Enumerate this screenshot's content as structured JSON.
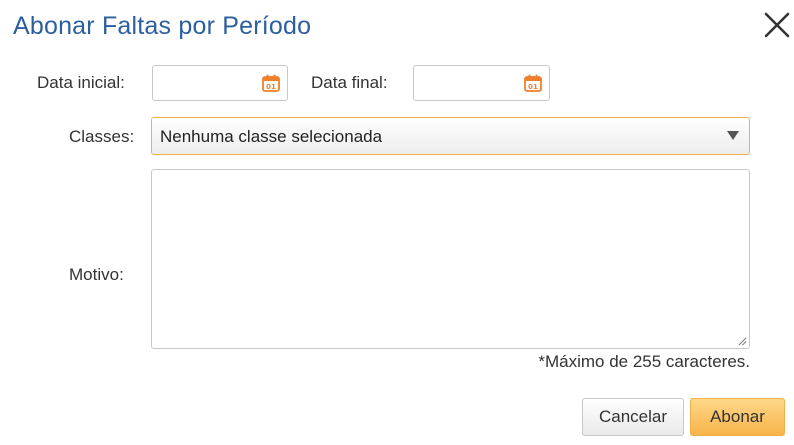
{
  "dialog": {
    "title": "Abonar Faltas por Período"
  },
  "form": {
    "start_date_label": "Data inicial:",
    "start_date_value": "",
    "end_date_label": "Data final:",
    "end_date_value": "",
    "classes_label": "Classes:",
    "classes_selected": "Nenhuma classe selecionada",
    "reason_label": "Motivo:",
    "reason_value": "",
    "reason_hint": "*Máximo de 255 caracteres."
  },
  "buttons": {
    "cancel_label": "Cancelar",
    "confirm_label": "Abonar"
  },
  "icons": {
    "close": "close-icon",
    "calendar": "calendar-icon",
    "dropdown": "chevron-down-icon",
    "resize": "resize-handle-icon"
  },
  "colors": {
    "title": "#2b5f9e",
    "accent": "#f0b04a",
    "calendar_icon": "#f07f2a"
  }
}
